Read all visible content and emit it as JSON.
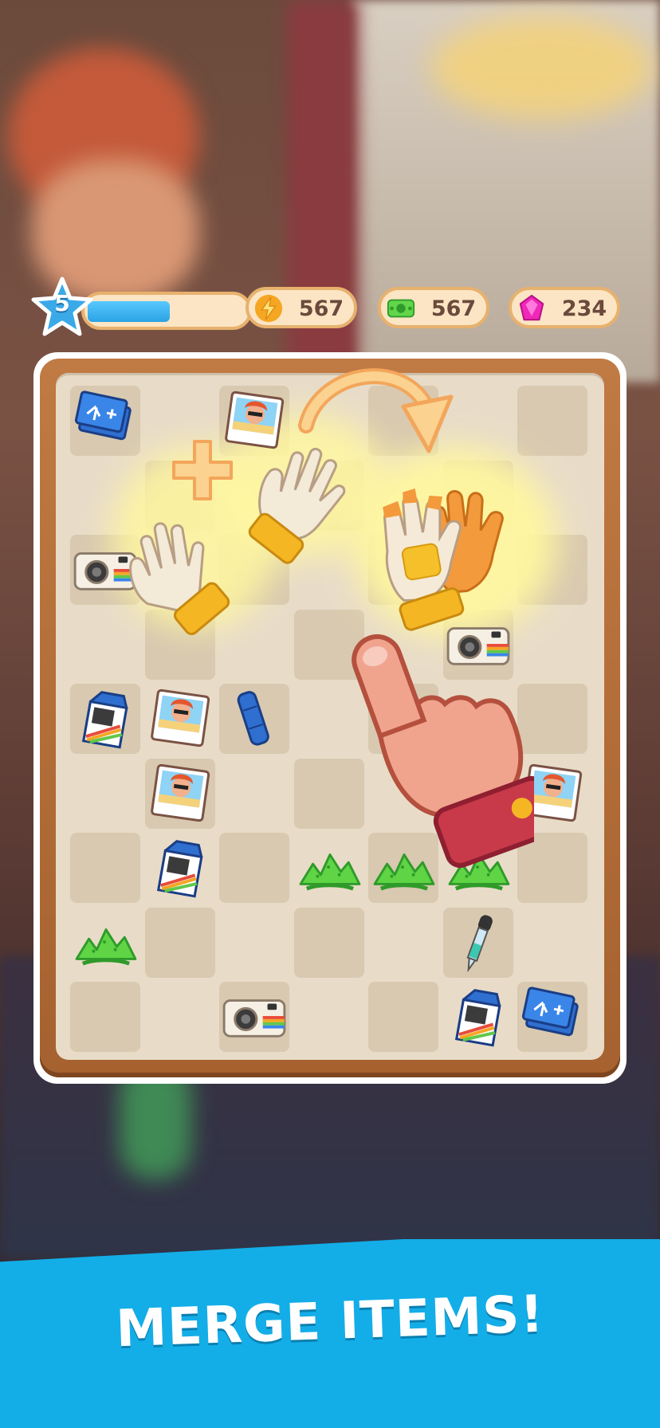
{
  "hud": {
    "level": "5",
    "xp_progress": 0.52,
    "energy": {
      "icon": "lightning-icon",
      "value": "567"
    },
    "cash": {
      "icon": "cash-icon",
      "value": "567"
    },
    "gems": {
      "icon": "gem-icon",
      "value": "234"
    }
  },
  "banner": {
    "text": "MERGE ITEMS!"
  },
  "board": {
    "columns": 7,
    "rows": 9,
    "items": [
      {
        "type": "blueprint",
        "col": 0,
        "row": 0
      },
      {
        "type": "photo",
        "col": 2,
        "row": 0
      },
      {
        "type": "camera",
        "col": 0,
        "row": 2
      },
      {
        "type": "camera",
        "col": 5,
        "row": 3
      },
      {
        "type": "milk-carton",
        "col": 0,
        "row": 4
      },
      {
        "type": "photo",
        "col": 1,
        "row": 4
      },
      {
        "type": "towel",
        "col": 2,
        "row": 4
      },
      {
        "type": "photo",
        "col": 1,
        "row": 5
      },
      {
        "type": "photo",
        "col": 6,
        "row": 5
      },
      {
        "type": "milk-carton",
        "col": 1,
        "row": 6
      },
      {
        "type": "grass",
        "col": 3,
        "row": 6
      },
      {
        "type": "grass",
        "col": 4,
        "row": 6
      },
      {
        "type": "grass",
        "col": 5,
        "row": 6
      },
      {
        "type": "grass",
        "col": 0,
        "row": 7
      },
      {
        "type": "dropper",
        "col": 5,
        "row": 7
      },
      {
        "type": "camera",
        "col": 2,
        "row": 8
      },
      {
        "type": "milk-carton",
        "col": 5,
        "row": 8
      },
      {
        "type": "blueprint",
        "col": 6,
        "row": 8
      }
    ]
  },
  "tutorial": {
    "merge_from": [
      "glove",
      "glove"
    ],
    "merge_to": "work-glove",
    "hint_icons": [
      "plus-icon",
      "curved-arrow-icon",
      "pointing-hand-icon"
    ]
  }
}
